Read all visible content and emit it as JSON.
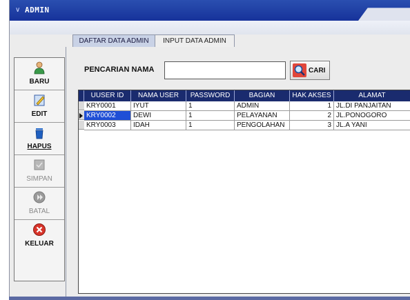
{
  "window": {
    "title": "ADMIN",
    "collapse_icon": "chevron-down-icon"
  },
  "tabs": [
    {
      "label": "DAFTAR DATA ADMIN",
      "active": true
    },
    {
      "label": "INPUT DATA ADMIN",
      "active": false
    }
  ],
  "toolbar": {
    "items": [
      {
        "label": "BARU",
        "icon": "user-icon",
        "enabled": true
      },
      {
        "label": "EDIT",
        "icon": "edit-icon",
        "enabled": true
      },
      {
        "label": "HAPUS",
        "icon": "trash-icon",
        "enabled": true
      },
      {
        "label": "SIMPAN",
        "icon": "save-icon",
        "enabled": false
      },
      {
        "label": "BATAL",
        "icon": "cancel-icon",
        "enabled": false
      },
      {
        "label": "KELUAR",
        "icon": "exit-icon",
        "enabled": true
      }
    ]
  },
  "search": {
    "label": "PENCARIAN NAMA",
    "value": "",
    "button_label": "CARI",
    "button_icon": "magnifier-icon"
  },
  "table": {
    "columns": [
      "UUSER ID",
      "NAMA USER",
      "PASSWORD",
      "BAGIAN",
      "HAK AKSES",
      "ALAMAT"
    ],
    "rows": [
      [
        "KRY0001",
        "IYUT",
        "1",
        "ADMIN",
        "1",
        "JL.DI PANJAITAN"
      ],
      [
        "KRY0002",
        "DEWI",
        "1",
        "PELAYANAN",
        "2",
        "JL.PONOGORO"
      ],
      [
        "KRY0003",
        "IDAH",
        "1",
        "PENGOLAHAN",
        "3",
        "JL.A YANI"
      ]
    ],
    "selected_row": 1
  },
  "colors": {
    "titlebar": "#1e3ea8",
    "header": "#1a2b6e",
    "selection": "#1f4fd6"
  }
}
